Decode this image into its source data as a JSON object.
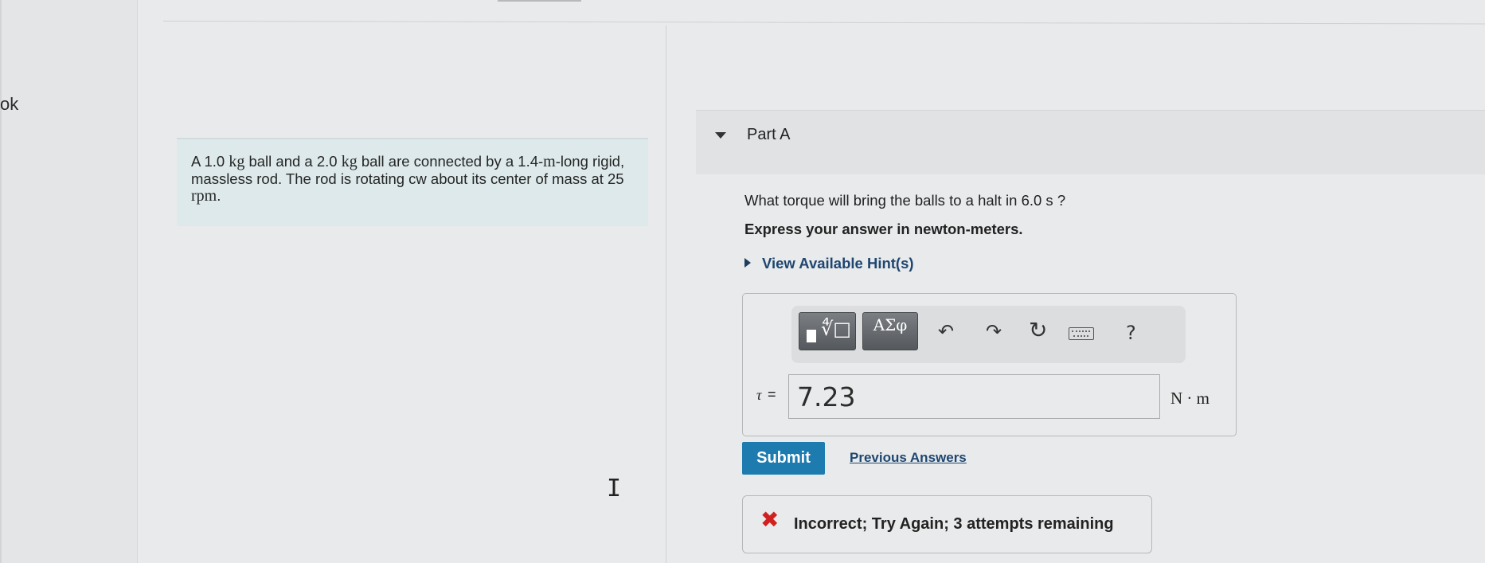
{
  "edge_text": "ok",
  "problem": {
    "text_1": "A 1.0 ",
    "unit_kg1": "kg",
    "text_2": " ball and a 2.0 ",
    "unit_kg2": "kg",
    "text_3": " ball are connected by a 1.4-",
    "unit_m": "m",
    "text_4": "-long rigid, massless rod. The rod is rotating cw about its center of mass at 25 ",
    "unit_rpm": "rpm",
    "text_5": "."
  },
  "part": {
    "title": "Part A",
    "question": "What torque will bring the balls to a halt in 6.0 s ?",
    "instruction": "Express your answer in newton-meters.",
    "hint_link": "View Available Hint(s)"
  },
  "toolbar": {
    "greek_label": "ΑΣφ",
    "templates_icon": "templates-icon",
    "undo_icon": "undo-icon",
    "redo_icon": "redo-icon",
    "reset_icon": "reset-icon",
    "keyboard_icon": "keyboard-icon",
    "help_label": "?"
  },
  "answer": {
    "variable": "τ",
    "equals": "=",
    "value": "7.23",
    "units": "N · m"
  },
  "actions": {
    "submit_label": "Submit",
    "previous_answers_label": "Previous Answers"
  },
  "feedback": {
    "icon": "x-icon",
    "color": "#d12020",
    "text": "Incorrect; Try Again; 3 attempts remaining"
  },
  "colors": {
    "submit_bg": "#1d7bb0",
    "link": "#1e4670",
    "problem_bg": "#dde9ea"
  }
}
